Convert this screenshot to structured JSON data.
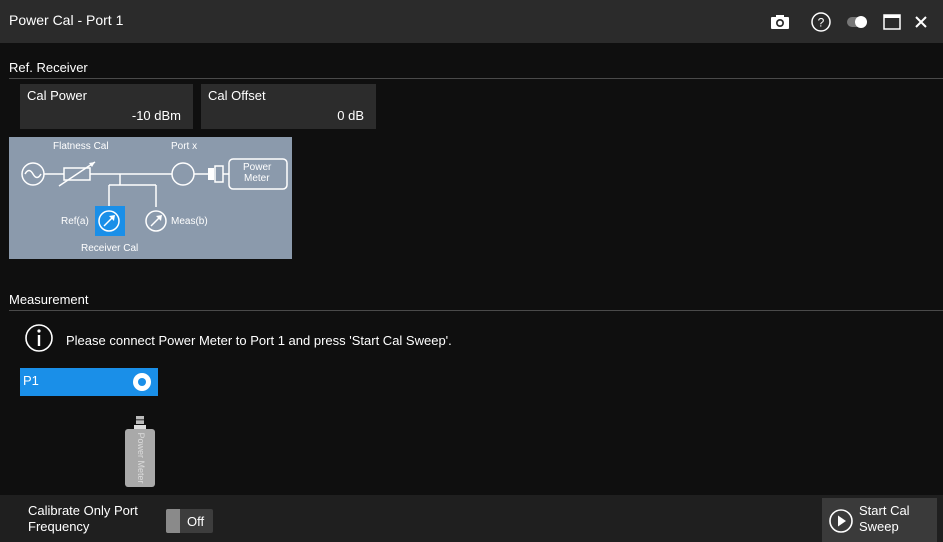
{
  "window": {
    "title": "Power Cal - Port 1",
    "icons": [
      "camera-icon",
      "help-icon",
      "toggle-icon",
      "maximize-icon",
      "close-icon"
    ]
  },
  "ref_receiver": {
    "section_label": "Ref. Receiver",
    "cal_power": {
      "label": "Cal Power",
      "value": "-10 dBm"
    },
    "cal_offset": {
      "label": "Cal Offset",
      "value": "0 dB"
    },
    "diagram": {
      "flatness_cal": "Flatness Cal",
      "port_x": "Port x",
      "power_meter_line1": "Power",
      "power_meter_line2": "Meter",
      "ref_a": "Ref(a)",
      "meas_b": "Meas(b)",
      "receiver_cal": "Receiver Cal"
    }
  },
  "measurement": {
    "section_label": "Measurement",
    "info_text": "Please connect Power Meter to Port 1 and press 'Start Cal Sweep'.",
    "port_label": "P1",
    "meter_text": "Power Meter"
  },
  "bottom": {
    "calibrate_line1": "Calibrate Only Port",
    "calibrate_line2": "Frequency",
    "toggle_value": "Off",
    "start_line1": "Start Cal",
    "start_line2": "Sweep"
  },
  "colors": {
    "accent": "#1a8fe8",
    "diagram_bg": "#8b9aac",
    "title_bg": "#2b2b2b"
  }
}
